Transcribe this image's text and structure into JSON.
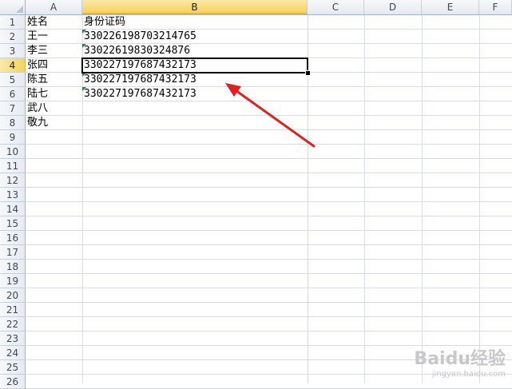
{
  "columns": [
    "A",
    "B",
    "C",
    "D",
    "E",
    "F"
  ],
  "rows": [
    "1",
    "2",
    "3",
    "4",
    "5",
    "6",
    "7",
    "8",
    "9",
    "10",
    "11",
    "12",
    "13",
    "14",
    "15",
    "16",
    "17",
    "18",
    "19",
    "20",
    "21",
    "22",
    "23",
    "24",
    "25",
    "26"
  ],
  "cells": {
    "A1": "姓名",
    "B1": "身份证码",
    "A2": "王一",
    "B2": "330226198703214765",
    "A3": "李三",
    "B3": "330226198303248​76",
    "A4": "张四",
    "B4": "330227197687432173",
    "A5": "陈五",
    "B5": "330227197687432173",
    "A6": "陆七",
    "B6": "330227197687432173",
    "A7": "武八",
    "A8": "敬九"
  },
  "active_cell": "B4",
  "active_column": "B",
  "active_row": "4",
  "watermark": {
    "logo": "Baidu经验",
    "url": "jingyan.baidu.com"
  },
  "colors": {
    "arrow": "#e02020",
    "selection": "#000000",
    "number_flag": "#1e8a3a"
  }
}
